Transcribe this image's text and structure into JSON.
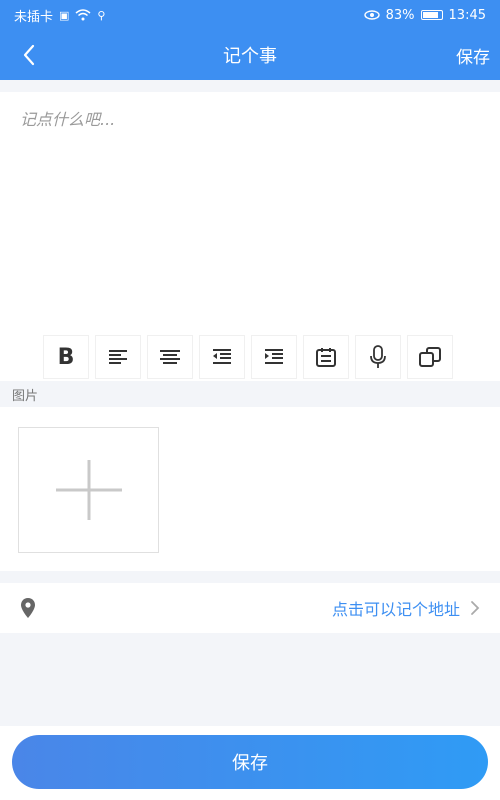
{
  "status_bar": {
    "carrier": "未插卡",
    "battery": "83%",
    "time": "13:45"
  },
  "nav": {
    "title": "记个事",
    "save_label": "保存"
  },
  "note": {
    "placeholder": "记点什么吧..."
  },
  "toolbar": {
    "bold_label": "B",
    "tools": [
      "bold-icon",
      "align-left-icon",
      "align-center-icon",
      "indent-decrease-icon",
      "indent-increase-icon",
      "checklist-icon",
      "microphone-icon",
      "copy-icon"
    ]
  },
  "images": {
    "label": "图片"
  },
  "location": {
    "text": "点击可以记个地址"
  },
  "footer": {
    "save_label": "保存"
  },
  "colors": {
    "primary": "#3d8ff2",
    "background": "#f3f5f9"
  }
}
